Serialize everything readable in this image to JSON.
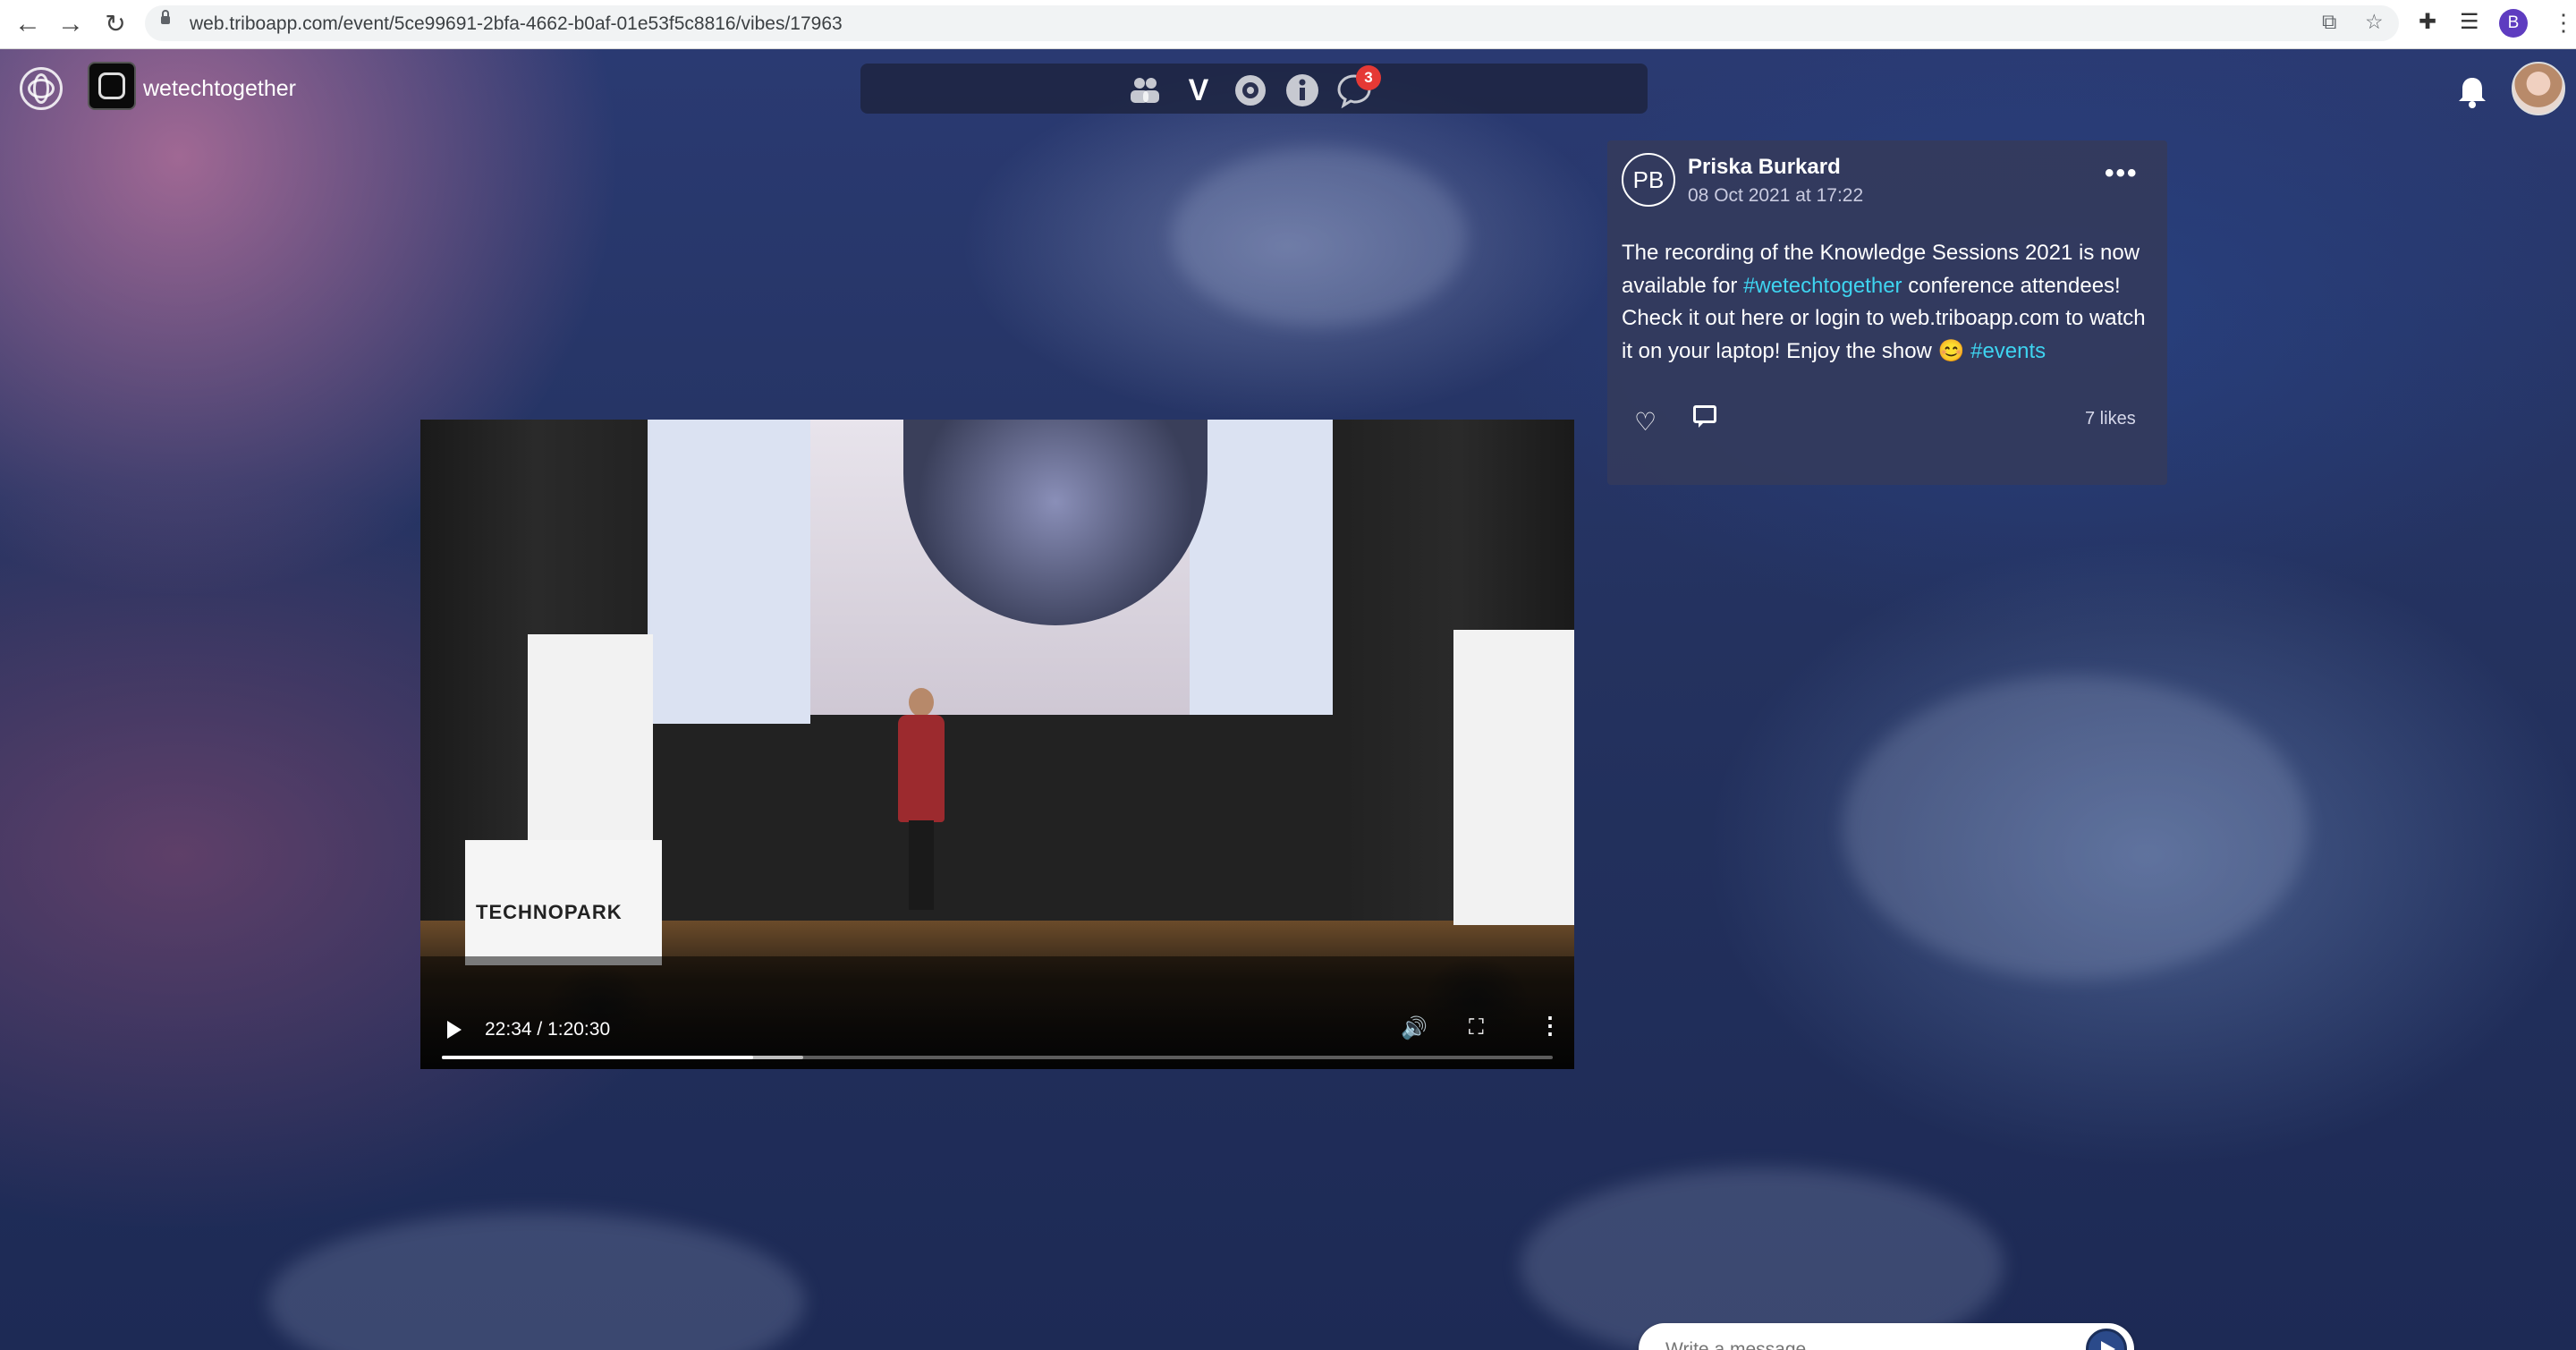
{
  "browser": {
    "url": "web.triboapp.com/event/5ce99691-2bfa-4662-b0af-01e53f5c8816/vibes/17963",
    "profile_initial": "B"
  },
  "app": {
    "community_name": "wetechtogether",
    "nav_icons": [
      "people-icon",
      "v-icon",
      "eye-icon",
      "info-icon",
      "chat-icon"
    ],
    "chat_badge": "3"
  },
  "video": {
    "time": "22:34 / 1:20:30",
    "progress_fraction": 0.28,
    "buffered_fraction": 0.325,
    "podium_text": "TECHNOPARK"
  },
  "post": {
    "initials": "PB",
    "author": "Priska Burkard",
    "date": "08 Oct 2021 at 17:22",
    "text_part1": "The recording of the Knowledge Sessions 2021 is now available for ",
    "hashtag1": "#wetechtogether",
    "text_part2": " conference attendees! Check it out here or login to web.triboapp.com to watch it on your laptop! Enjoy the show 😊 ",
    "hashtag2": "#events",
    "likes": "7 likes"
  },
  "composer": {
    "placeholder": "Write a message..."
  },
  "colors": {
    "hashtag": "#3ed4f0",
    "badge": "#e53935",
    "profile": "#5e3cc0"
  }
}
